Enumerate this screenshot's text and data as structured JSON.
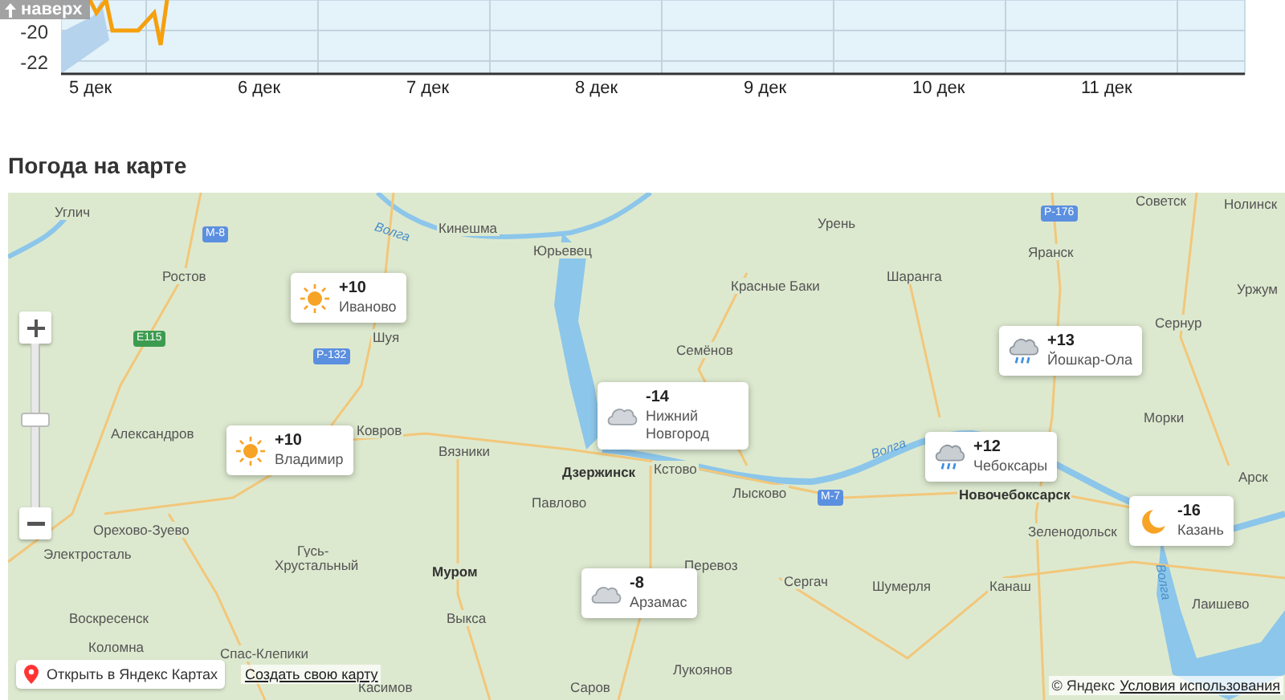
{
  "chart": {
    "scroll_top_button": "наверх",
    "y_ticks": [
      "-20",
      "-22"
    ],
    "x_labels": [
      "5 дек",
      "6 дек",
      "7 дек",
      "8 дек",
      "9 дек",
      "10 дек",
      "11 дек"
    ]
  },
  "map_section": {
    "title": "Погода на карте"
  },
  "map": {
    "cities": [
      "Углич",
      "Ростов",
      "Кинешма",
      "Юрьевец",
      "Шуя",
      "Александров",
      "Ковров",
      "Вязники",
      "Дзержинск",
      "Павлово",
      "Орехово-Зуево",
      "Электросталь",
      "Гусь-",
      "Хрустальный",
      "Муром",
      "Воскресенск",
      "Выкса",
      "Коломна",
      "Спас-Клепики",
      "Касимов",
      "Саров",
      "Урень",
      "Красные Баки",
      "Шаранга",
      "Семёнов",
      "Яранск",
      "Советск",
      "Нолинск",
      "Уржум",
      "Сернур",
      "Морки",
      "Кстово",
      "Лысково",
      "Новочебоксарск",
      "Зеленодольск",
      "Арск",
      "Перевоз",
      "Сергач",
      "Шумерля",
      "Канаш",
      "Лаишево",
      "Лукоянов"
    ],
    "rivers": [
      "Волга",
      "Волга",
      "Волга"
    ],
    "roads": [
      "М-8",
      "E115",
      "Р-132",
      "Р-176",
      "М-7"
    ],
    "markers": [
      {
        "kind": "sun",
        "temp": "+10",
        "city": "Иваново"
      },
      {
        "kind": "sun",
        "temp": "+10",
        "city": "Владимир"
      },
      {
        "kind": "cloud",
        "temp": "-14",
        "city": "Нижний Новгород"
      },
      {
        "kind": "cloud",
        "temp": "-8",
        "city": "Арзамас"
      },
      {
        "kind": "rain",
        "temp": "+13",
        "city": "Йошкар-Ола"
      },
      {
        "kind": "rain",
        "temp": "+12",
        "city": "Чебоксары"
      },
      {
        "kind": "moon",
        "temp": "-16",
        "city": "Казань"
      }
    ],
    "open_button": "Открыть в Яндекс Картах",
    "create_link": "Создать свою карту",
    "copyright": "© Яндекс",
    "terms_link": "Условия использования"
  }
}
